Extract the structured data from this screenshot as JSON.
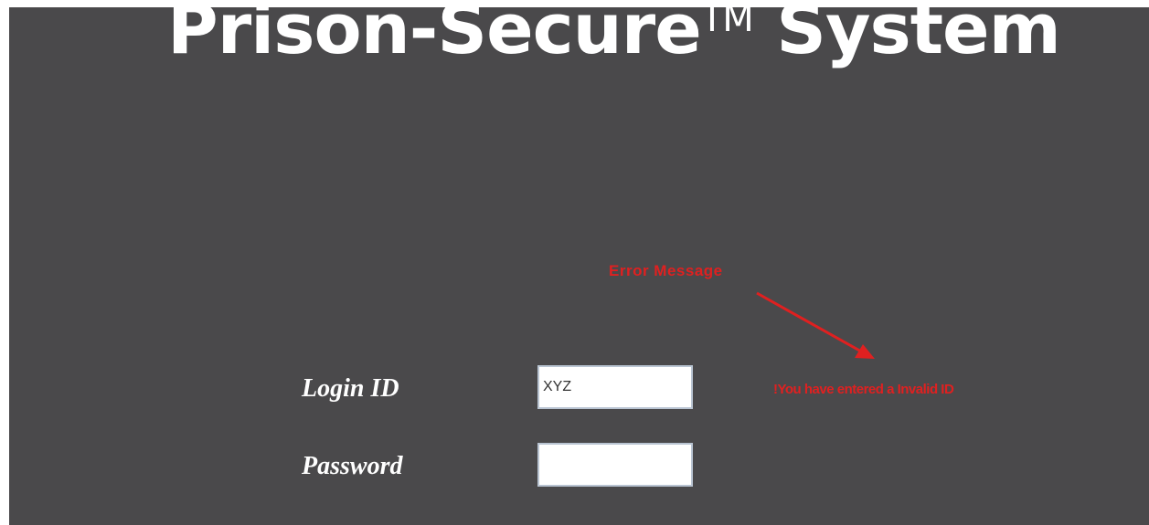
{
  "header": {
    "title": "Prison-Secure",
    "trademark": "TM",
    "title_suffix": " System"
  },
  "annotation": {
    "label": "Error Message",
    "color": "#e02020"
  },
  "form": {
    "login_label": "Login ID",
    "login_value": "XYZ",
    "password_label": "Password",
    "password_value": ""
  },
  "error": {
    "message": "!You have entered a Invalid ID"
  },
  "colors": {
    "background": "#4a494b",
    "text": "#ffffff",
    "error": "#e02020"
  }
}
